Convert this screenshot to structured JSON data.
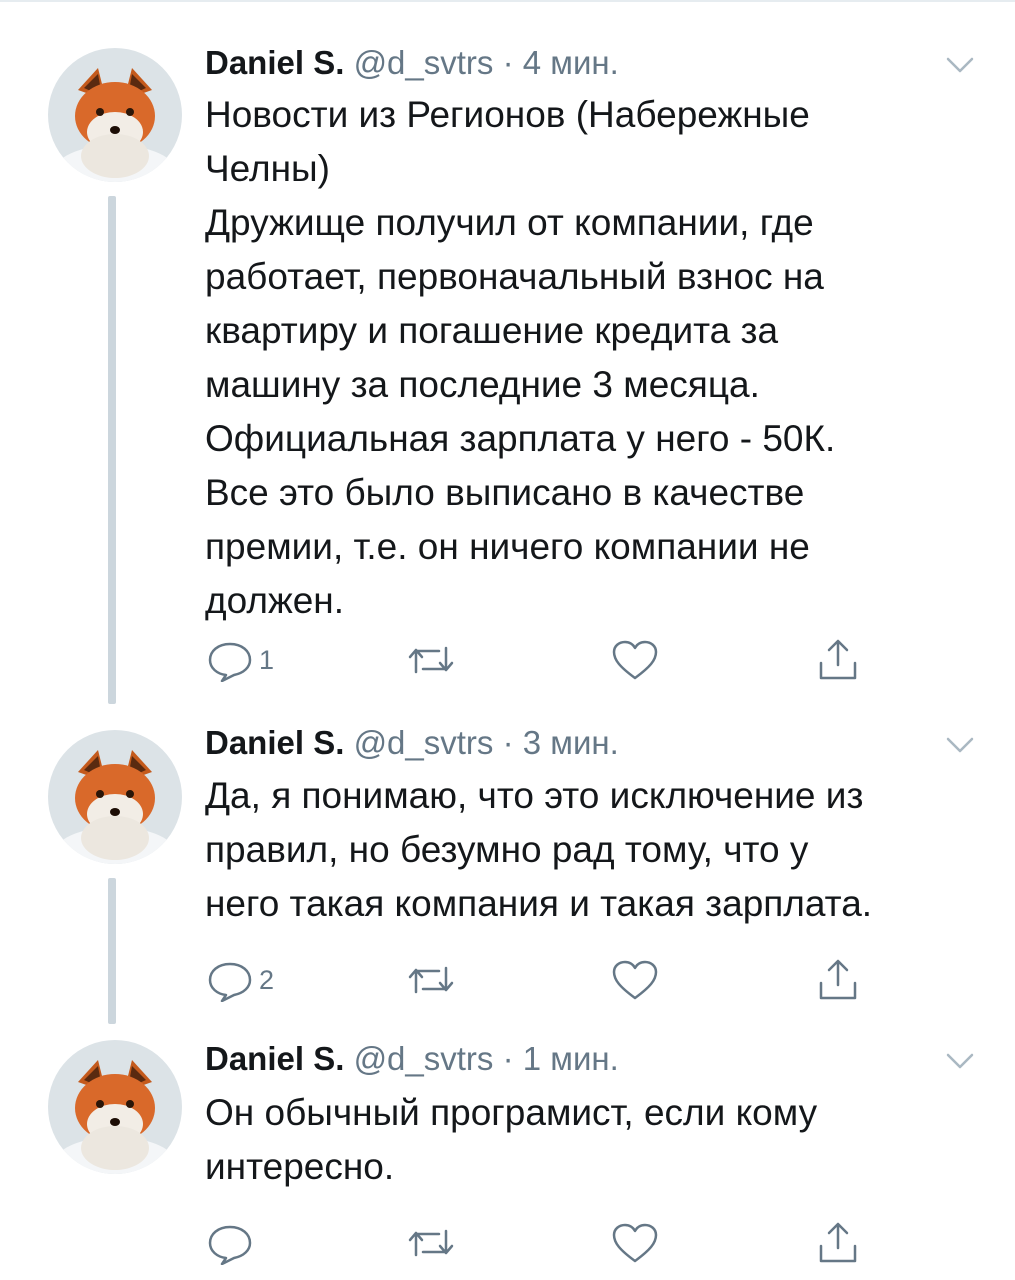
{
  "tweets": [
    {
      "name": "Daniel S.",
      "handle": "@d_svtrs",
      "separator": "·",
      "time": "4 мин.",
      "lines": [
        "Новости из Регионов (Набережные",
        "Челны)",
        "Дружище получил от компании, где",
        "работает, первоначальный взнос на",
        "квартиру и погашение кредита за",
        "машину за последние 3 месяца.",
        "Официальная зарплата у него - 50К.",
        "Все это было выписано в качестве",
        "премии, т.е. он ничего компании не",
        "должен."
      ],
      "reply_count": "1"
    },
    {
      "name": "Daniel S.",
      "handle": "@d_svtrs",
      "separator": "·",
      "time": "3 мин.",
      "lines": [
        "Да, я понимаю, что это исключение из",
        "правил, но безумно рад тому, что у",
        "него такая компания и такая зарплата."
      ],
      "reply_count": "2"
    },
    {
      "name": "Daniel S.",
      "handle": "@d_svtrs",
      "separator": "·",
      "time": "1 мин.",
      "lines": [
        "Он обычный програмист, если кому",
        "интересно."
      ],
      "reply_count": ""
    }
  ],
  "icons": {
    "reply": "reply-icon",
    "retweet": "retweet-icon",
    "like": "heart-icon",
    "share": "share-icon",
    "menu": "chevron-down-icon",
    "avatar": "fox-avatar"
  },
  "colors": {
    "text": "#14171a",
    "secondary": "#657786",
    "thread_line": "#ccd6dd",
    "divider": "#e6ecf0"
  }
}
